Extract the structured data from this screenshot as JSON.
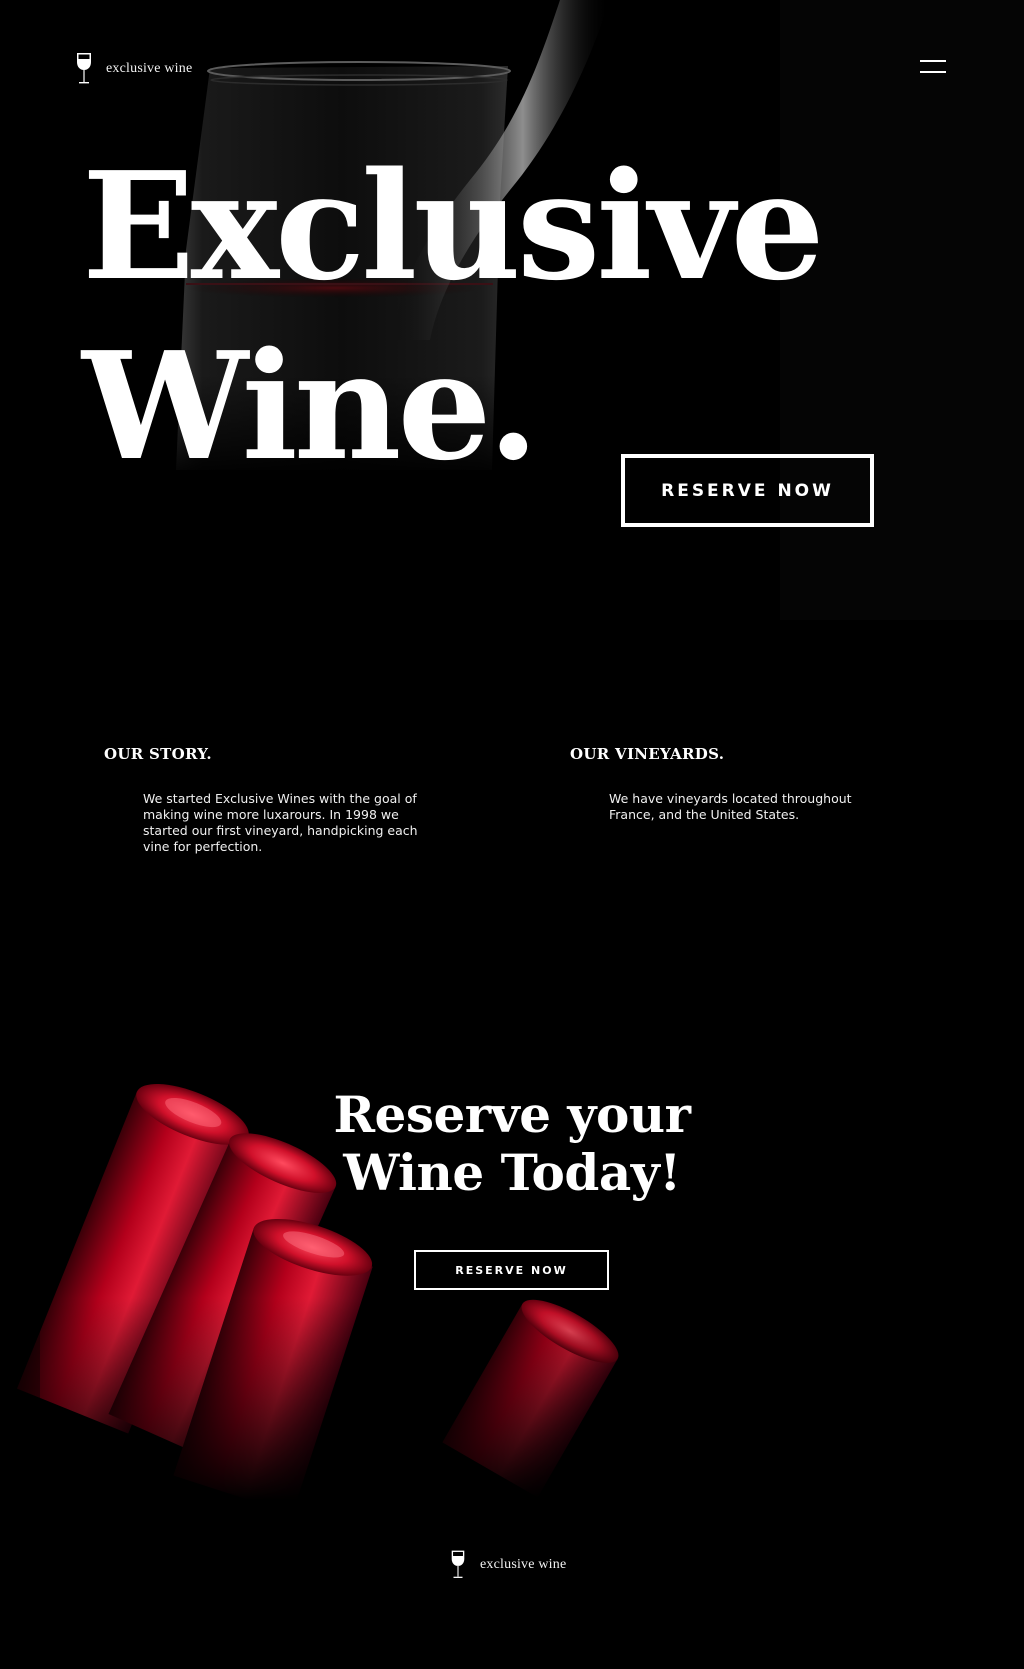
{
  "header": {
    "brand_name": "exclusive wine",
    "logo_icon": "wine-glass-icon",
    "menu_icon": "hamburger-menu-icon"
  },
  "hero": {
    "title_line1": "Exclusive",
    "title_line2": "Wine.",
    "cta_label": "RESERVE NOW"
  },
  "about": {
    "story": {
      "heading": "OUR STORY.",
      "text": "We started Exclusive Wines with the goal of making wine more luxarours. In 1998 we started our first vineyard, handpicking each vine for perfection."
    },
    "vineyards": {
      "heading": "OUR VINEYARDS.",
      "text": "We have vineyards located throughout France, and the United States."
    }
  },
  "reserve": {
    "title_line1": "Reserve your",
    "title_line2": "Wine Today!",
    "cta_label": "RESERVE NOW"
  },
  "footer": {
    "brand_name": "exclusive wine",
    "logo_icon": "wine-glass-icon"
  },
  "colors": {
    "background": "#000000",
    "text": "#ffffff",
    "accent_wine_red": "#b3001b"
  }
}
